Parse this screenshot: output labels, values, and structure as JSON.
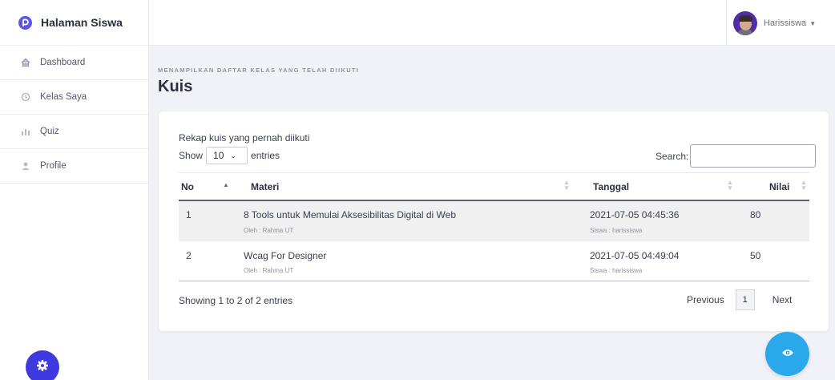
{
  "brand": {
    "name": "Halaman Siswa",
    "color": "#5a55e6"
  },
  "sidebar": {
    "items": [
      {
        "label": "Dashboard",
        "icon": "home-icon"
      },
      {
        "label": "Kelas Saya",
        "icon": "history-icon"
      },
      {
        "label": "Quiz",
        "icon": "bar-chart-icon"
      },
      {
        "label": "Profile",
        "icon": "user-icon"
      }
    ]
  },
  "topbar": {
    "username": "Harissiswa"
  },
  "header": {
    "kicker": "MENAMPILKAN DAFTAR KELAS YANG TELAH DIIKUTI",
    "title": "Kuis"
  },
  "card": {
    "title": "Rekap kuis yang pernah diikuti",
    "show_label": "Show",
    "entries_value": "10",
    "entries_label": "entries",
    "search_label": "Search:",
    "search_value": ""
  },
  "table": {
    "columns": [
      "No",
      "Materi",
      "Tanggal",
      "Nilai"
    ],
    "rows": [
      {
        "no": "1",
        "materi": "8 Tools untuk Memulai Aksesibilitas Digital di Web",
        "oleh": "Oleh : Rahma UT",
        "tanggal": "2021-07-05 04:45:36",
        "siswa": "Siswa : harissiswa",
        "nilai": "80"
      },
      {
        "no": "2",
        "materi": "Wcag For Designer",
        "oleh": "Oleh : Rahma UT",
        "tanggal": "2021-07-05 04:49:04",
        "siswa": "Siswa : harissiswa",
        "nilai": "50"
      }
    ]
  },
  "pagination": {
    "info": "Showing 1 to 2 of 2 entries",
    "previous": "Previous",
    "current_page": "1",
    "next": "Next"
  },
  "colors": {
    "settings": "#3f3ae0",
    "fab": "#29a8ec"
  }
}
